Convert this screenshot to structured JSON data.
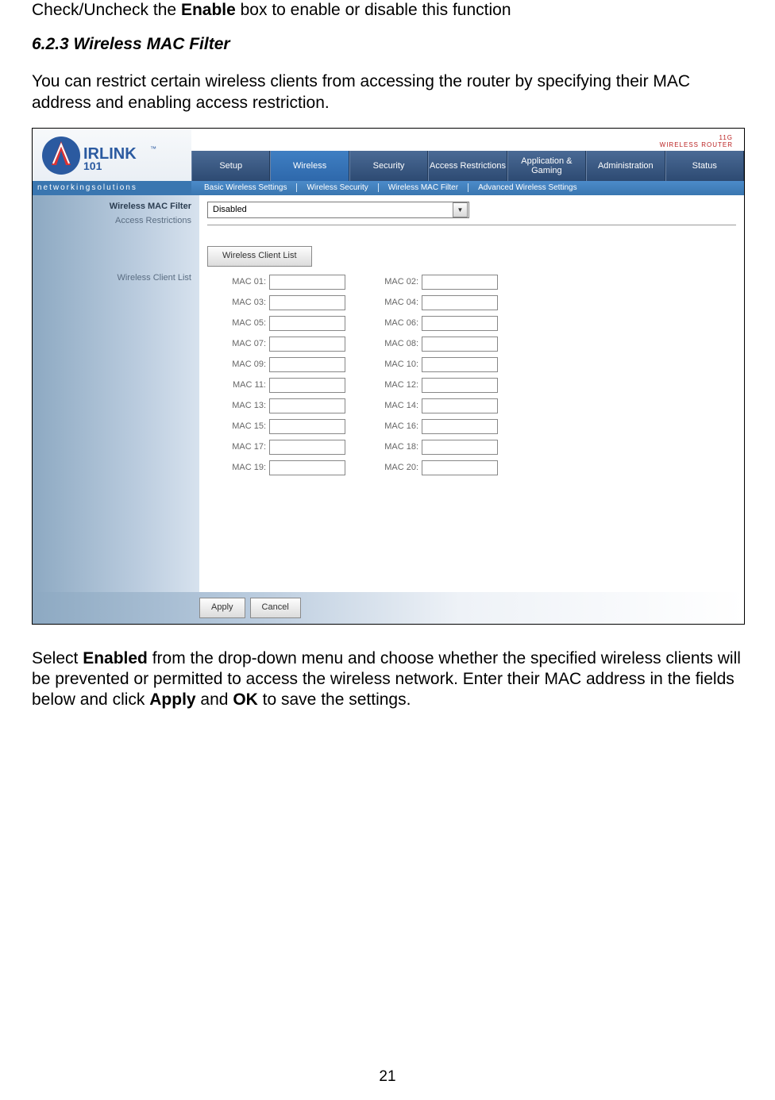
{
  "intro_line_prefix": "Check/Uncheck the ",
  "intro_line_bold": "Enable",
  "intro_line_suffix": " box to enable or disable this function",
  "section_heading": "6.2.3 Wireless MAC Filter",
  "para1": "You can restrict certain wireless clients from accessing the router by specifying their MAC address and enabling access restriction.",
  "para2_pre": "Select ",
  "para2_b1": "Enabled",
  "para2_mid1": " from the drop-down menu and choose whether the specified wireless clients will be prevented or permitted to access the wireless network. Enter their MAC address in the fields below and click ",
  "para2_b2": "Apply",
  "para2_mid2": " and ",
  "para2_b3": "OK",
  "para2_suf": " to save the settings.",
  "page_number": "21",
  "router_ui": {
    "brand": "AIRLINK101",
    "brand_sub": "networkingsolutions",
    "badge_top": "11G",
    "badge_bottom": "WIRELESS ROUTER",
    "main_tabs": [
      "Setup",
      "Wireless",
      "Security",
      "Access Restrictions",
      "Application & Gaming",
      "Administration",
      "Status"
    ],
    "active_main_tab": "Wireless",
    "sub_tabs": [
      "Basic Wireless Settings",
      "Wireless Security",
      "Wireless MAC Filter",
      "Advanced Wireless Settings"
    ],
    "side_title": "Wireless MAC Filter",
    "side_label1": "Access Restrictions",
    "side_label2": "Wireless Client List",
    "dropdown_value": "Disabled",
    "wcl_button": "Wireless Client List",
    "mac_labels": [
      "MAC 01:",
      "MAC 02:",
      "MAC 03:",
      "MAC 04:",
      "MAC 05:",
      "MAC 06:",
      "MAC 07:",
      "MAC 08:",
      "MAC 09:",
      "MAC 10:",
      "MAC 11:",
      "MAC 12:",
      "MAC 13:",
      "MAC 14:",
      "MAC 15:",
      "MAC 16:",
      "MAC 17:",
      "MAC 18:",
      "MAC 19:",
      "MAC 20:"
    ],
    "apply": "Apply",
    "cancel": "Cancel"
  }
}
